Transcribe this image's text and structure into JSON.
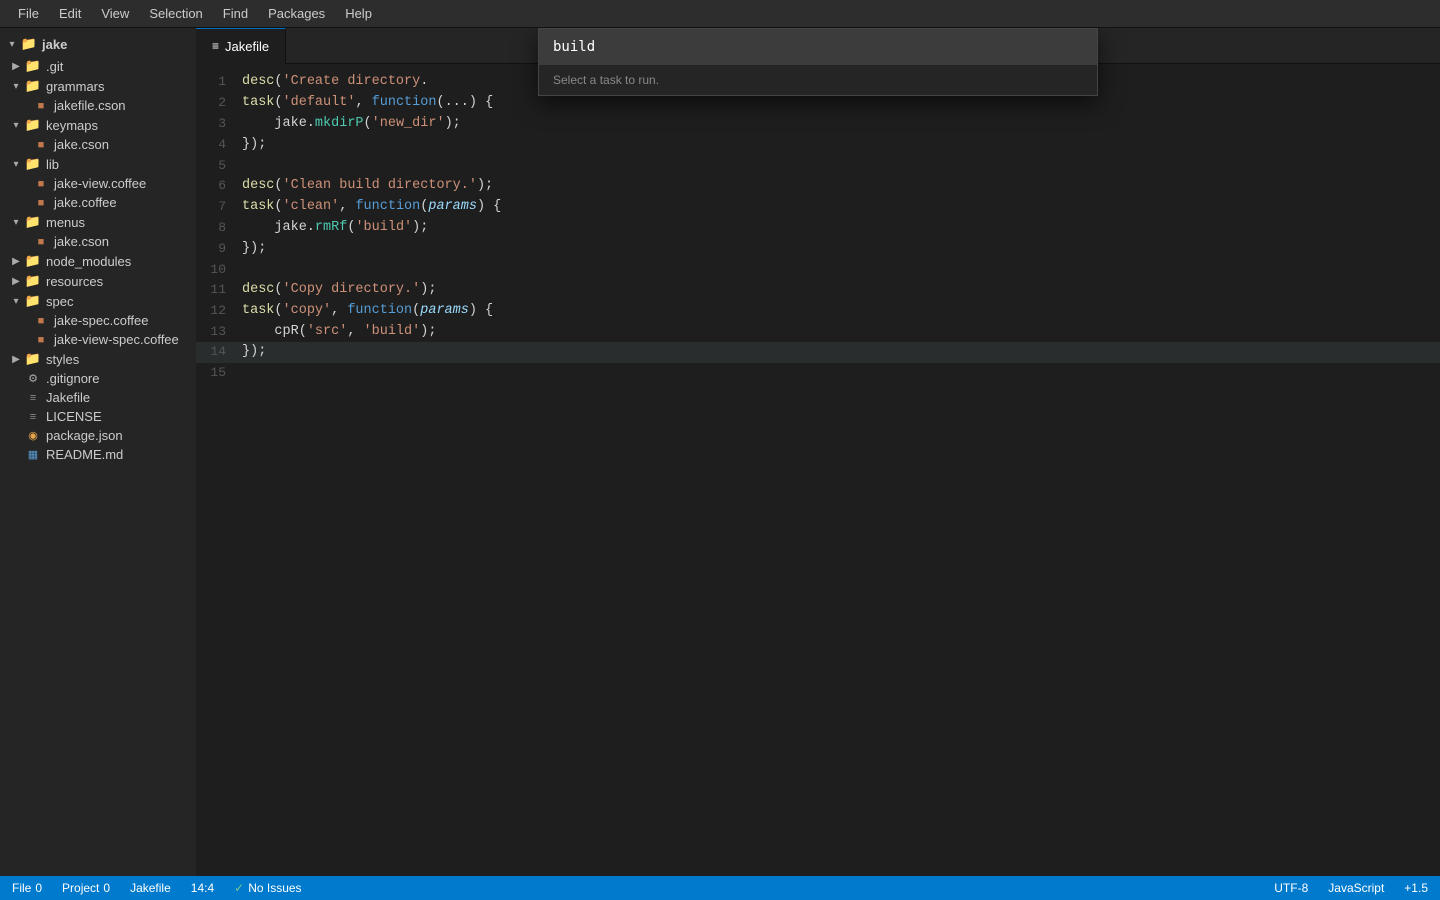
{
  "menubar": {
    "items": [
      "File",
      "Edit",
      "View",
      "Selection",
      "Find",
      "Packages",
      "Help"
    ]
  },
  "sidebar": {
    "root_label": "jake",
    "items": [
      {
        "id": "git",
        "label": ".git",
        "type": "folder",
        "depth": 1,
        "collapsed": true,
        "color": "blue"
      },
      {
        "id": "grammars",
        "label": "grammars",
        "type": "folder",
        "depth": 1,
        "collapsed": false,
        "color": "orange"
      },
      {
        "id": "jakefile-cson",
        "label": "jakefile.cson",
        "type": "file-cson",
        "depth": 2
      },
      {
        "id": "keymaps",
        "label": "keymaps",
        "type": "folder",
        "depth": 1,
        "collapsed": false,
        "color": "orange"
      },
      {
        "id": "jake-cson",
        "label": "jake.cson",
        "type": "file-cson",
        "depth": 2
      },
      {
        "id": "lib",
        "label": "lib",
        "type": "folder",
        "depth": 1,
        "collapsed": false,
        "color": "orange"
      },
      {
        "id": "jake-view-coffee",
        "label": "jake-view.coffee",
        "type": "file-coffee",
        "depth": 2
      },
      {
        "id": "jake-coffee",
        "label": "jake.coffee",
        "type": "file-coffee",
        "depth": 2
      },
      {
        "id": "menus",
        "label": "menus",
        "type": "folder",
        "depth": 1,
        "collapsed": false,
        "color": "orange"
      },
      {
        "id": "jake-cson2",
        "label": "jake.cson",
        "type": "file-cson",
        "depth": 2
      },
      {
        "id": "node_modules",
        "label": "node_modules",
        "type": "folder",
        "depth": 1,
        "collapsed": true,
        "color": "orange"
      },
      {
        "id": "resources",
        "label": "resources",
        "type": "folder",
        "depth": 1,
        "collapsed": true,
        "color": "orange"
      },
      {
        "id": "spec",
        "label": "spec",
        "type": "folder",
        "depth": 1,
        "collapsed": false,
        "color": "orange"
      },
      {
        "id": "jake-spec-coffee",
        "label": "jake-spec.coffee",
        "type": "file-coffee",
        "depth": 2
      },
      {
        "id": "jake-view-spec-coffee",
        "label": "jake-view-spec.coffee",
        "type": "file-coffee",
        "depth": 2
      },
      {
        "id": "styles",
        "label": "styles",
        "type": "folder",
        "depth": 1,
        "collapsed": true,
        "color": "orange"
      },
      {
        "id": "gitignore",
        "label": ".gitignore",
        "type": "file-git",
        "depth": 1
      },
      {
        "id": "jakefile",
        "label": "Jakefile",
        "type": "file-generic",
        "depth": 1
      },
      {
        "id": "license",
        "label": "LICENSE",
        "type": "file-generic",
        "depth": 1
      },
      {
        "id": "package-json",
        "label": "package.json",
        "type": "file-package",
        "depth": 1
      },
      {
        "id": "readme-md",
        "label": "README.md",
        "type": "file-md",
        "depth": 1
      }
    ]
  },
  "tab": {
    "label": "Jakefile",
    "icon": "file"
  },
  "editor": {
    "lines": [
      {
        "num": 1,
        "tokens": [
          {
            "t": "str",
            "v": "desc('Create directory"
          },
          {
            "t": "plain",
            "v": "."
          }
        ]
      },
      {
        "num": 2,
        "tokens": [
          {
            "t": "fn",
            "v": "task"
          },
          {
            "t": "plain",
            "v": "("
          },
          {
            "t": "str",
            "v": "'default'"
          },
          {
            "t": "plain",
            "v": ", "
          },
          {
            "t": "kw",
            "v": "function"
          },
          {
            "t": "plain",
            "v": "("
          },
          {
            "t": "plain",
            "v": "..."
          },
          {
            "t": "plain",
            "v": ") {"
          }
        ]
      },
      {
        "num": 3,
        "tokens": [
          {
            "t": "plain",
            "v": "    jake."
          },
          {
            "t": "method",
            "v": "mkdirP"
          },
          {
            "t": "plain",
            "v": "("
          },
          {
            "t": "str",
            "v": "'new_dir'"
          },
          {
            "t": "plain",
            "v": ");"
          }
        ]
      },
      {
        "num": 4,
        "tokens": [
          {
            "t": "plain",
            "v": "});"
          }
        ]
      },
      {
        "num": 5,
        "tokens": []
      },
      {
        "num": 6,
        "tokens": [
          {
            "t": "fn",
            "v": "desc"
          },
          {
            "t": "plain",
            "v": "("
          },
          {
            "t": "str",
            "v": "'Clean build directory.'"
          },
          {
            "t": "plain",
            "v": ");"
          }
        ]
      },
      {
        "num": 7,
        "tokens": [
          {
            "t": "fn",
            "v": "task"
          },
          {
            "t": "plain",
            "v": "("
          },
          {
            "t": "str",
            "v": "'clean'"
          },
          {
            "t": "plain",
            "v": ", "
          },
          {
            "t": "kw",
            "v": "function"
          },
          {
            "t": "plain",
            "v": "("
          },
          {
            "t": "param",
            "v": "params"
          },
          {
            "t": "plain",
            "v": ") {"
          }
        ]
      },
      {
        "num": 8,
        "tokens": [
          {
            "t": "plain",
            "v": "    jake."
          },
          {
            "t": "method",
            "v": "rmRf"
          },
          {
            "t": "plain",
            "v": "("
          },
          {
            "t": "str",
            "v": "'build'"
          },
          {
            "t": "plain",
            "v": ");"
          }
        ]
      },
      {
        "num": 9,
        "tokens": [
          {
            "t": "plain",
            "v": "});"
          }
        ]
      },
      {
        "num": 10,
        "tokens": []
      },
      {
        "num": 11,
        "tokens": [
          {
            "t": "fn",
            "v": "desc"
          },
          {
            "t": "plain",
            "v": "("
          },
          {
            "t": "str",
            "v": "'Copy directory.'"
          },
          {
            "t": "plain",
            "v": ");"
          }
        ]
      },
      {
        "num": 12,
        "tokens": [
          {
            "t": "fn",
            "v": "task"
          },
          {
            "t": "plain",
            "v": "("
          },
          {
            "t": "str",
            "v": "'copy'"
          },
          {
            "t": "plain",
            "v": ", "
          },
          {
            "t": "kw",
            "v": "function"
          },
          {
            "t": "plain",
            "v": "("
          },
          {
            "t": "param",
            "v": "params"
          },
          {
            "t": "plain",
            "v": ") {"
          }
        ]
      },
      {
        "num": 13,
        "tokens": [
          {
            "t": "plain",
            "v": "    cpR("
          },
          {
            "t": "str",
            "v": "'src'"
          },
          {
            "t": "plain",
            "v": ", "
          },
          {
            "t": "str",
            "v": "'build'"
          },
          {
            "t": "plain",
            "v": ");"
          }
        ]
      },
      {
        "num": 14,
        "tokens": [
          {
            "t": "plain",
            "v": "});"
          }
        ]
      },
      {
        "num": 15,
        "tokens": []
      }
    ]
  },
  "command_palette": {
    "input_value": "build",
    "hint": "Select a task to run."
  },
  "statusbar": {
    "file_label": "File",
    "file_count": "0",
    "project_label": "Project",
    "project_count": "0",
    "jakefile_label": "Jakefile",
    "position": "14:4",
    "no_issues": "No Issues",
    "encoding": "UTF-8",
    "language": "JavaScript",
    "indent": "+1.5"
  }
}
